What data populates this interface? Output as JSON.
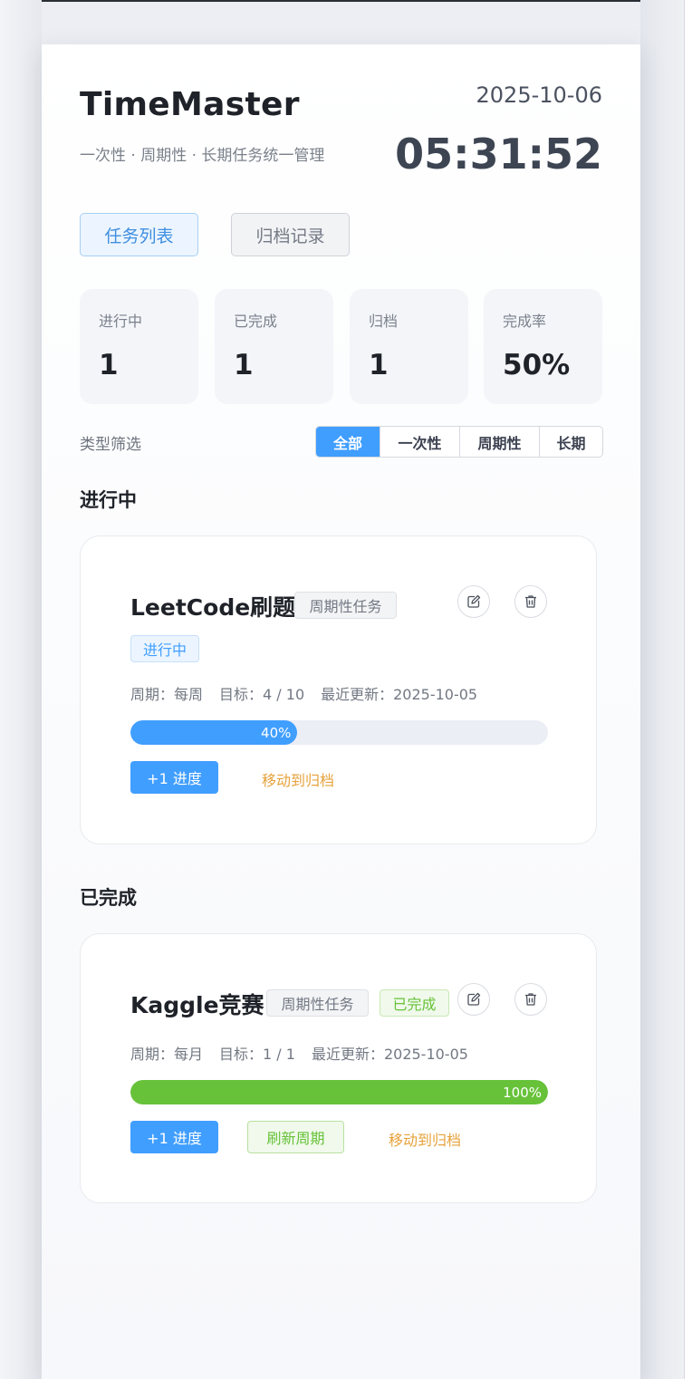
{
  "header": {
    "title": "TimeMaster",
    "subtitle": "一次性 · 周期性 · 长期任务统一管理",
    "date": "2025-10-06",
    "clock": "05:31:52"
  },
  "tabs": [
    {
      "label": "任务列表",
      "active": true
    },
    {
      "label": "归档记录",
      "active": false
    }
  ],
  "stats": [
    {
      "label": "进行中",
      "value": "1"
    },
    {
      "label": "已完成",
      "value": "1"
    },
    {
      "label": "归档",
      "value": "1"
    },
    {
      "label": "完成率",
      "value": "50%"
    }
  ],
  "filter": {
    "label": "类型筛选",
    "options": [
      "全部",
      "一次性",
      "周期性",
      "长期"
    ],
    "selected": "全部"
  },
  "sections": [
    {
      "title": "进行中",
      "tasks": [
        {
          "name": "LeetCode刷题",
          "type_tag": "周期性任务",
          "status_tag": "进行中",
          "period": "周期：每周",
          "target": "目标：4 / 10",
          "updated": "最近更新：2025-10-05",
          "progress": 0.4,
          "progress_label": "40%",
          "progress_color": "#409eff",
          "actions": {
            "progress": "+1 进度",
            "archive": "移动到归档"
          }
        }
      ]
    },
    {
      "title": "已完成",
      "tasks": [
        {
          "name": "Kaggle竞赛",
          "type_tag": "周期性任务",
          "status_tag": "已完成",
          "period": "周期：每月",
          "target": "目标：1 / 1",
          "updated": "最近更新：2025-10-05",
          "progress": 1.0,
          "progress_label": "100%",
          "progress_color": "#67c23a",
          "actions": {
            "progress": "+1 进度",
            "refresh": "刷新周期",
            "archive": "移动到归档"
          }
        }
      ]
    }
  ],
  "icons": {
    "edit": "edit-icon",
    "delete": "trash-icon"
  }
}
